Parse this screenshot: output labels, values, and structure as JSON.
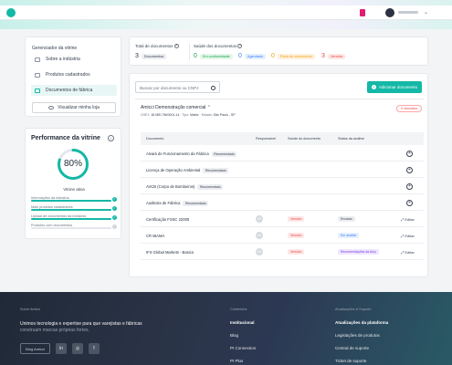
{
  "menu": {
    "title": "Gerenciador da vitrine",
    "items": [
      {
        "label": "Sobre a indústria"
      },
      {
        "label": "Produtos cadastrados"
      },
      {
        "label": "Documentos de fábrica"
      }
    ],
    "visit_label": "Visualizar minha loja"
  },
  "performance": {
    "title": "Performance da vitrine",
    "percent_label": "80%",
    "percent": 80,
    "subtitle": "Vitrine ativa",
    "checks": [
      {
        "label": "Informações da indústria",
        "fill": 1.0,
        "done": true
      },
      {
        "label": "Mais produtos cadastrados",
        "fill": 1.0,
        "done": true
      },
      {
        "label": "Upload de documentos da indústria",
        "fill": 1.0,
        "done": true
      },
      {
        "label": "Produtos com documentos",
        "fill": 0.0,
        "done": false
      }
    ]
  },
  "stats": {
    "total_head": "Total de documentos",
    "status_head": "Saúde dos documentos",
    "total": {
      "num": "3",
      "label": "Documentos"
    },
    "items": [
      {
        "num": "0",
        "label": "Em conformidade",
        "color": "#16a34a",
        "bg": "#e4f6ea"
      },
      {
        "num": "0",
        "label": "Agendado",
        "color": "#3b82f6",
        "bg": "#e6effd"
      },
      {
        "num": "0",
        "label": "Perto do vencimento",
        "color": "#f59e0b",
        "bg": "#fdf0dc"
      },
      {
        "num": "3",
        "label": "Vencido",
        "color": "#ef4444",
        "bg": "#fde8e6"
      }
    ]
  },
  "main": {
    "search_placeholder": "Buscar por documento ou CNPJ",
    "add_label": "Adicionar documento",
    "company": "Amicci Demonstração comercial",
    "company_meta": {
      "cnpj_label": "CNPJ:",
      "cnpj": "18.085.796/0001-14",
      "type_label": "Tipo:",
      "type": "Matriz",
      "state_label": "Estado:",
      "state": "São Paulo - SP"
    },
    "expired_badge": "3 vencidos",
    "columns": [
      "Documento",
      "Responsável",
      "Saúde do documento",
      "Status da análise"
    ],
    "rows": [
      {
        "doc": "Alvará de Funcionamento da Fábrica",
        "tag": "Recomendado",
        "action": "add"
      },
      {
        "doc": "Licença de Operação Ambiental",
        "tag": "Recomendado",
        "action": "add"
      },
      {
        "doc": "AVCB (Corpo de Bombeiros)",
        "tag": "Recomendado",
        "action": "add"
      },
      {
        "doc": "Auditoria de Fábrica",
        "tag": "Recomendado",
        "action": "add"
      },
      {
        "doc": "Certificação FSSC 22000",
        "tag": "",
        "resp": "AS",
        "health": "Vencido",
        "status": "Enviado",
        "status_color": "#374151",
        "status_bg": "#eceef1",
        "action": "edit"
      },
      {
        "doc": "CR IBAMA",
        "tag": "",
        "resp": "AS",
        "health": "Vencido",
        "status": "Em análise",
        "status_color": "#3b82f6",
        "status_bg": "#e6effd",
        "action": "edit"
      },
      {
        "doc": "IFS Global Markets - Basico",
        "tag": "",
        "resp": "AS",
        "health": "Vencido",
        "status": "Recomendações da Amy",
        "status_color": "#7c3aed",
        "status_bg": "#efe7fd",
        "action": "edit"
      }
    ],
    "edit_label": "Editar"
  },
  "footer": {
    "about_title": "Sobre Amicci",
    "tagline_1": "Unimos tecnologia e expertise para que varejistas e fábricas",
    "tagline_2": "construam marcas próprias fortes.",
    "button": "Blog Amicci",
    "col2_title": "Conteúdos",
    "col2": [
      "Institucional",
      "Blog",
      "PI Connection",
      "PI Plus"
    ],
    "col3_title": "Atualizações & Suporte",
    "col3": [
      "Atualizações da plataforma",
      "Legislações de produtos",
      "Central de suporte",
      "Ticket de suporte"
    ]
  }
}
